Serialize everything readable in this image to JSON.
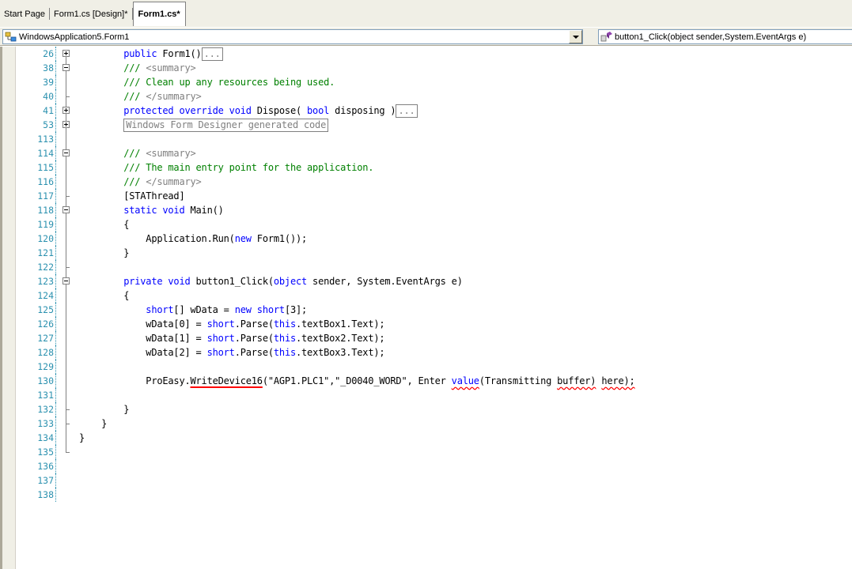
{
  "tabs": [
    {
      "label": "Start Page",
      "active": false
    },
    {
      "label": "Form1.cs [Design]*",
      "active": false
    },
    {
      "label": "Form1.cs*",
      "active": true
    }
  ],
  "nav": {
    "class_combo": "WindowsApplication5.Form1",
    "member_combo": "button1_Click(object sender,System.EventArgs e)"
  },
  "editor": {
    "lines": [
      {
        "num": "26",
        "outline": "plus",
        "tokens": [
          {
            "t": "        "
          },
          {
            "t": "public",
            "c": "kw"
          },
          {
            "t": " Form1()"
          },
          {
            "t": "...",
            "c": "collapsed"
          }
        ]
      },
      {
        "num": "38",
        "outline": "minus",
        "tokens": [
          {
            "t": "        "
          },
          {
            "t": "/// ",
            "c": "cm"
          },
          {
            "t": "<summary>",
            "c": "cmx"
          }
        ]
      },
      {
        "num": "39",
        "outline": "line",
        "tokens": [
          {
            "t": "        "
          },
          {
            "t": "/// Clean up any resources being used.",
            "c": "cm"
          }
        ]
      },
      {
        "num": "40",
        "outline": "end",
        "tokens": [
          {
            "t": "        "
          },
          {
            "t": "/// ",
            "c": "cm"
          },
          {
            "t": "</summary>",
            "c": "cmx"
          }
        ]
      },
      {
        "num": "41",
        "outline": "plus",
        "tokens": [
          {
            "t": "        "
          },
          {
            "t": "protected override void",
            "c": "kw"
          },
          {
            "t": " Dispose( "
          },
          {
            "t": "bool",
            "c": "kw"
          },
          {
            "t": " disposing )"
          },
          {
            "t": "...",
            "c": "collapsed"
          }
        ]
      },
      {
        "num": "53",
        "outline": "plus",
        "tokens": [
          {
            "t": "        "
          },
          {
            "t": "Windows Form Designer generated code",
            "c": "collapsed"
          }
        ]
      },
      {
        "num": "113",
        "outline": "line",
        "tokens": []
      },
      {
        "num": "114",
        "outline": "minus",
        "tokens": [
          {
            "t": "        "
          },
          {
            "t": "/// ",
            "c": "cm"
          },
          {
            "t": "<summary>",
            "c": "cmx"
          }
        ]
      },
      {
        "num": "115",
        "outline": "line",
        "tokens": [
          {
            "t": "        "
          },
          {
            "t": "/// The main entry point for the application.",
            "c": "cm"
          }
        ]
      },
      {
        "num": "116",
        "outline": "line",
        "tokens": [
          {
            "t": "        "
          },
          {
            "t": "/// ",
            "c": "cm"
          },
          {
            "t": "</summary>",
            "c": "cmx"
          }
        ]
      },
      {
        "num": "117",
        "outline": "end",
        "tokens": [
          {
            "t": "        [STAThread]"
          }
        ]
      },
      {
        "num": "118",
        "outline": "minus",
        "tokens": [
          {
            "t": "        "
          },
          {
            "t": "static void",
            "c": "kw"
          },
          {
            "t": " Main()"
          }
        ]
      },
      {
        "num": "119",
        "outline": "line",
        "tokens": [
          {
            "t": "        {"
          }
        ]
      },
      {
        "num": "120",
        "outline": "line",
        "tokens": [
          {
            "t": "            Application.Run("
          },
          {
            "t": "new",
            "c": "kw"
          },
          {
            "t": " Form1());"
          }
        ]
      },
      {
        "num": "121",
        "outline": "line",
        "tokens": [
          {
            "t": "        }"
          }
        ]
      },
      {
        "num": "122",
        "outline": "end",
        "tokens": []
      },
      {
        "num": "123",
        "outline": "minus",
        "tokens": [
          {
            "t": "        "
          },
          {
            "t": "private void",
            "c": "kw"
          },
          {
            "t": " button1_Click("
          },
          {
            "t": "object",
            "c": "kw"
          },
          {
            "t": " sender, System.EventArgs e)"
          }
        ]
      },
      {
        "num": "124",
        "outline": "line",
        "tokens": [
          {
            "t": "        {"
          }
        ]
      },
      {
        "num": "125",
        "outline": "line",
        "tokens": [
          {
            "t": "            "
          },
          {
            "t": "short",
            "c": "kw"
          },
          {
            "t": "[] wData = "
          },
          {
            "t": "new short",
            "c": "kw"
          },
          {
            "t": "[3];"
          }
        ]
      },
      {
        "num": "126",
        "outline": "line",
        "tokens": [
          {
            "t": "            wData[0] = "
          },
          {
            "t": "short",
            "c": "kw"
          },
          {
            "t": ".Parse("
          },
          {
            "t": "this",
            "c": "kw"
          },
          {
            "t": ".textBox1.Text);"
          }
        ]
      },
      {
        "num": "127",
        "outline": "line",
        "tokens": [
          {
            "t": "            wData[1] = "
          },
          {
            "t": "short",
            "c": "kw"
          },
          {
            "t": ".Parse("
          },
          {
            "t": "this",
            "c": "kw"
          },
          {
            "t": ".textBox2.Text);"
          }
        ]
      },
      {
        "num": "128",
        "outline": "line",
        "tokens": [
          {
            "t": "            wData[2] = "
          },
          {
            "t": "short",
            "c": "kw"
          },
          {
            "t": ".Parse("
          },
          {
            "t": "this",
            "c": "kw"
          },
          {
            "t": ".textBox3.Text);"
          }
        ]
      },
      {
        "num": "129",
        "outline": "line",
        "tokens": []
      },
      {
        "num": "130",
        "outline": "line",
        "tokens": [
          {
            "t": "            ProEasy."
          },
          {
            "t": "WriteDevice16",
            "c": "err-red"
          },
          {
            "t": "(\"AGP1.PLC1\",\"_D0040_WORD\", Enter "
          },
          {
            "t": "value",
            "c": "kw err-wavy"
          },
          {
            "t": "(Transmitting "
          },
          {
            "t": "buffer)",
            "c": "err-wavy"
          },
          {
            "t": " "
          },
          {
            "t": "here);",
            "c": "err-wavy"
          }
        ]
      },
      {
        "num": "131",
        "outline": "line",
        "tokens": []
      },
      {
        "num": "132",
        "outline": "end",
        "tokens": [
          {
            "t": "        }"
          }
        ]
      },
      {
        "num": "133",
        "outline": "end",
        "tokens": [
          {
            "t": "    }"
          }
        ]
      },
      {
        "num": "134",
        "outline": "line",
        "tokens": [
          {
            "t": "}"
          }
        ]
      },
      {
        "num": "135",
        "outline": "last",
        "tokens": []
      },
      {
        "num": "136",
        "outline": "none",
        "tokens": []
      },
      {
        "num": "137",
        "outline": "none",
        "tokens": []
      },
      {
        "num": "138",
        "outline": "none",
        "tokens": []
      }
    ]
  }
}
